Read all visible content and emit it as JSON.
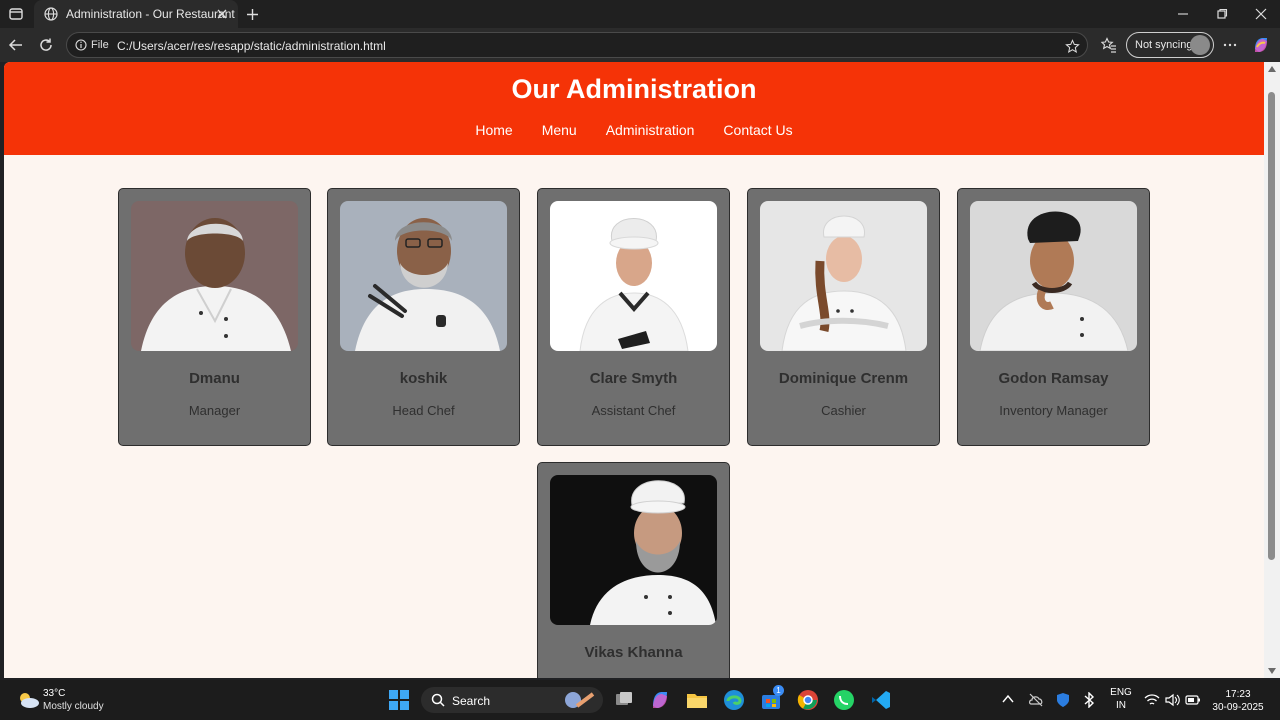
{
  "browser": {
    "tab_title": "Administration - Our Restaurant",
    "url_scheme_label": "File",
    "url": "C:/Users/acer/res/resapp/static/administration.html",
    "sync_label": "Not syncing"
  },
  "site": {
    "title": "Our Administration",
    "nav": [
      "Home",
      "Menu",
      "Administration",
      "Contact Us"
    ],
    "accent": "#f53307",
    "page_bg": "#fdf5f0",
    "card_bg": "#6f6f6f"
  },
  "staff": [
    {
      "name": "Dmanu",
      "role": "Manager"
    },
    {
      "name": "koshik",
      "role": "Head Chef"
    },
    {
      "name": "Clare Smyth",
      "role": "Assistant Chef"
    },
    {
      "name": "Dominique Crenm",
      "role": "Cashier"
    },
    {
      "name": "Godon Ramsay",
      "role": "Inventory Manager"
    },
    {
      "name": "Vikas Khanna",
      "role": ""
    }
  ],
  "taskbar": {
    "weather_temp": "33°C",
    "weather_desc": "Mostly cloudy",
    "search_label": "Search",
    "lang_top": "ENG",
    "lang_bottom": "IN",
    "time": "17:23",
    "date": "30-09-2025",
    "store_badge": "1"
  }
}
